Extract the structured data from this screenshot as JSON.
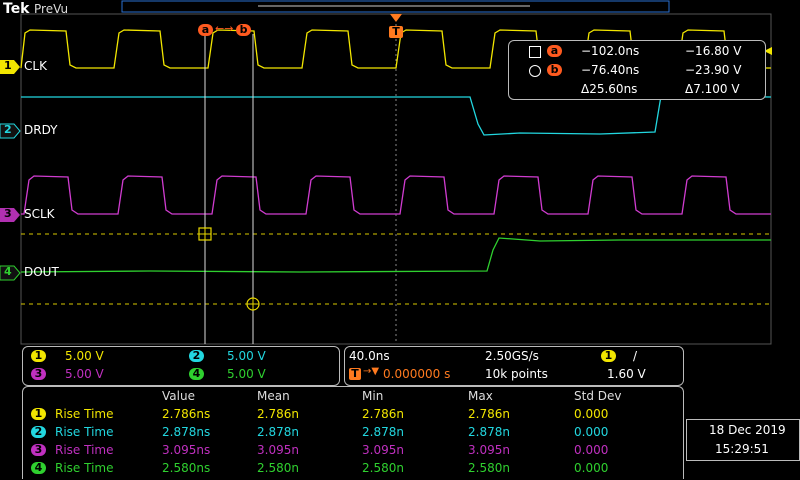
{
  "header": {
    "brand": "Tek",
    "mode": "PreVu"
  },
  "colors": {
    "ch1": "#f2e600",
    "ch2": "#22d7e0",
    "ch3": "#d03cd0",
    "ch4": "#2fd02f",
    "cursor": "#ff5a1f"
  },
  "channels": [
    {
      "num": "1",
      "name": "CLK"
    },
    {
      "num": "2",
      "name": "DRDY"
    },
    {
      "num": "3",
      "name": "SCLK"
    },
    {
      "num": "4",
      "name": "DOUT"
    }
  ],
  "trigger_marker": "T",
  "cursors": {
    "a_label": "a",
    "b_label": "b",
    "a_time": "−102.0ns",
    "a_volt": "−16.80 V",
    "b_time": "−76.40ns",
    "b_volt": "−23.90 V",
    "delta_time": "Δ25.60ns",
    "delta_volt": "Δ7.100 V"
  },
  "vertical_scales": [
    {
      "num": "1",
      "value": "5.00 V"
    },
    {
      "num": "2",
      "value": "5.00 V"
    },
    {
      "num": "3",
      "value": "5.00 V"
    },
    {
      "num": "4",
      "value": "5.00 V"
    }
  ],
  "horizontal": {
    "time_per_div": "40.0ns",
    "sample_rate": "2.50GS/s",
    "trigger_delay": "0.000000 s",
    "record_length": "10k points",
    "trigger_source": "1",
    "trigger_slope": "/",
    "trigger_level": "1.60 V"
  },
  "measurements": {
    "headers": [
      "Value",
      "Mean",
      "Min",
      "Max",
      "Std Dev"
    ],
    "rows": [
      {
        "num": "1",
        "name": "Rise Time",
        "value": "2.786ns",
        "mean": "2.786n",
        "min": "2.786n",
        "max": "2.786n",
        "std": "0.000"
      },
      {
        "num": "2",
        "name": "Rise Time",
        "value": "2.878ns",
        "mean": "2.878n",
        "min": "2.878n",
        "max": "2.878n",
        "std": "0.000"
      },
      {
        "num": "3",
        "name": "Rise Time",
        "value": "3.095ns",
        "mean": "3.095n",
        "min": "3.095n",
        "max": "3.095n",
        "std": "0.000"
      },
      {
        "num": "4",
        "name": "Rise Time",
        "value": "2.580ns",
        "mean": "2.580n",
        "min": "2.580n",
        "max": "2.580n",
        "std": "0.000"
      }
    ]
  },
  "datetime": {
    "date": "18 Dec  2019",
    "time": "15:29:51"
  }
}
